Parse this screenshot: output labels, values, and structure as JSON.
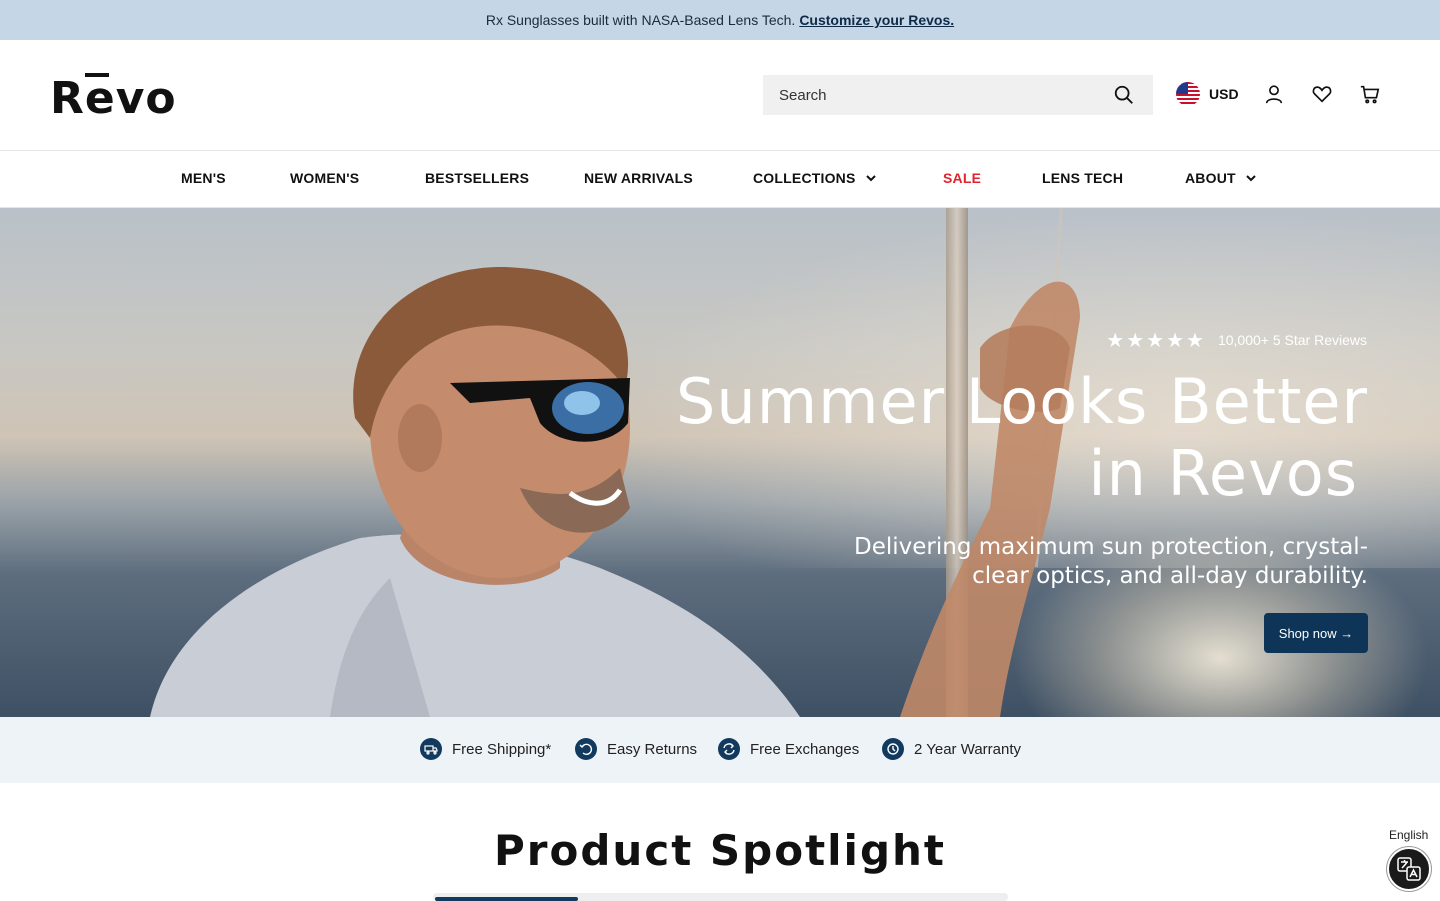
{
  "announcement": {
    "text": "Rx Sunglasses built with NASA-Based Lens Tech.",
    "link": "Customize your Revos."
  },
  "header": {
    "logo_alt": "Rēvo",
    "search_placeholder": "Search",
    "currency": "USD",
    "icons": [
      "search-icon",
      "us-flag-icon",
      "account-icon",
      "wishlist-heart-icon",
      "cart-icon"
    ]
  },
  "nav": {
    "items": [
      {
        "label": "MEN'S"
      },
      {
        "label": "WOMEN'S"
      },
      {
        "label": "BESTSELLERS"
      },
      {
        "label": "NEW ARRIVALS"
      },
      {
        "label": "COLLECTIONS"
      },
      {
        "label": "SALE"
      },
      {
        "label": "LENS TECH"
      },
      {
        "label": "ABOUT"
      }
    ],
    "sale_color": "#e0242f"
  },
  "hero": {
    "rating_stars": 5,
    "rating_text": "10,000+ 5 Star Reviews",
    "headline_line1": "Summer Looks Better",
    "headline_line2": "in Revos",
    "subline": "Delivering maximum sun protection, crystal-clear optics, and all-day durability.",
    "cta": "Shop now →",
    "cta_color": "#0e3457"
  },
  "perks": [
    {
      "label": "Free Shipping*",
      "icon": "shipping-icon"
    },
    {
      "label": "Easy Returns",
      "icon": "returns-icon"
    },
    {
      "label": "Free Exchanges",
      "icon": "exchange-icon"
    },
    {
      "label": "2 Year Warranty",
      "icon": "warranty-icon"
    }
  ],
  "spotlight": {
    "title": "Product Spotlight"
  },
  "language": {
    "label": "English",
    "icon": "translate-icon"
  }
}
